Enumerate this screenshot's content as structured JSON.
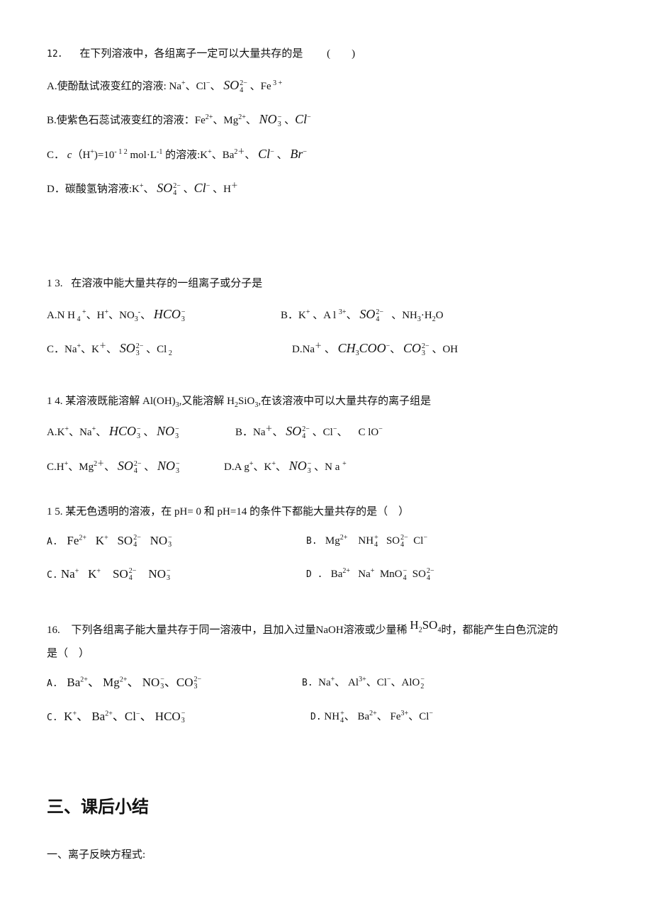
{
  "questions": [
    {
      "number": "12．",
      "stem": "在下列溶液中，各组离子一定可以大量共存的是",
      "paren": "(　　)",
      "options": {
        "A": {
          "label": "A.",
          "text": "使酚酞试液变红的溶液: "
        },
        "B": {
          "label": "B.",
          "text": "使紫色石蕊试液变红的溶液："
        },
        "C": {
          "label": "C．",
          "text": "(H⁺)=10⁻¹² mol·L⁻¹的溶液:"
        },
        "D": {
          "label": "D．",
          "text": "碳酸氢钠溶液:"
        }
      }
    },
    {
      "number": "1 3.",
      "stem": "在溶液中能大量共存的一组离子或分子是"
    },
    {
      "number": "1 4.",
      "stem": "某溶液既能溶解 Al(OH)₃,又能溶解 H₂SiO₃,在该溶液中可以大量共存的离子组是"
    },
    {
      "number": "1 5.",
      "stem": "某无色透明的溶液，在 pH= 0 和 pH=14 的条件下都能大量共存的是（　）"
    },
    {
      "number": "16.",
      "stem": "下列各组离子能大量共存于同一溶液中，且加入过量NaOH溶液或少量稀",
      "stem_tail": "时，都能产生白色沉淀的",
      "stem_line2": "是（　）"
    }
  ],
  "labels": {
    "A": "A.",
    "B": "B.",
    "C": "C.",
    "D": "D.",
    "Cdot": "C．",
    "Ddot": "D．",
    "Bdot": "B．",
    "Ad": "A．",
    "Dsp": "D ."
  },
  "text": {
    "q12a": "使酚酞试液变红的溶液: ",
    "q12b": "使紫色石蕊试液变红的溶液：",
    "q12c_pre": "（H",
    "q12c_mid": ")=10",
    "q12c_unit": " mol·L",
    "q12c_post": " 的溶液:",
    "q12d": "碳酸氢钠溶液:",
    "q14_stem_a": "某溶液既能溶解 Al(OH)",
    "q14_stem_b": ",又能溶解 H",
    "q14_stem_c": "SiO",
    "q14_stem_d": ",在该溶液中可以大量共存的离子组是"
  },
  "summary": {
    "heading": "三、课后小结",
    "item1": "一、离子反映方程式:"
  }
}
